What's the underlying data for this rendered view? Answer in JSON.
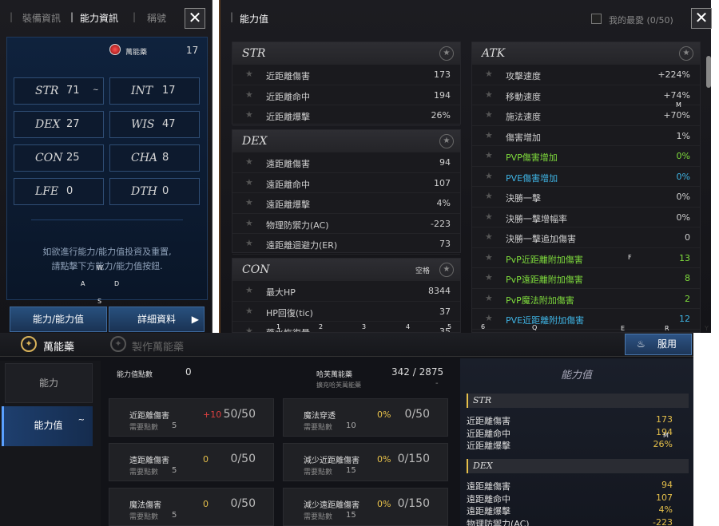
{
  "left_panel": {
    "tabs": [
      "裝備資訊",
      "能力資訊",
      "稱號"
    ],
    "elixir_label": "萬能藥",
    "elixir_count": "17",
    "stats": [
      {
        "name": "STR",
        "value": "71"
      },
      {
        "name": "INT",
        "value": "17"
      },
      {
        "name": "DEX",
        "value": "27"
      },
      {
        "name": "WIS",
        "value": "47"
      },
      {
        "name": "CON",
        "value": "25"
      },
      {
        "name": "CHA",
        "value": "8"
      },
      {
        "name": "LFE",
        "value": "0"
      },
      {
        "name": "DTH",
        "value": "0"
      }
    ],
    "hint_line1": "如欲進行能力/能力值投資及重置,",
    "hint_line2": "請點擊下方能力/能力值按鈕.",
    "btn_stats": "能力/能力值",
    "btn_details": "詳細資料"
  },
  "right_panel": {
    "title": "能力值",
    "favorites": "我的最愛 (0/50)",
    "str": {
      "title": "STR",
      "rows": [
        {
          "label": "近距離傷害",
          "value": "173"
        },
        {
          "label": "近距離命中",
          "value": "194"
        },
        {
          "label": "近距離爆擊",
          "value": "26%"
        }
      ]
    },
    "dex": {
      "title": "DEX",
      "rows": [
        {
          "label": "遠距離傷害",
          "value": "94"
        },
        {
          "label": "遠距離命中",
          "value": "107"
        },
        {
          "label": "遠距離爆擊",
          "value": "4%"
        },
        {
          "label": "物理防禦力(AC)",
          "value": "-223"
        },
        {
          "label": "遠距離迴避力(ER)",
          "value": "73"
        }
      ]
    },
    "con": {
      "title": "CON",
      "tag": "空格",
      "rows": [
        {
          "label": "最大HP",
          "value": "8344"
        },
        {
          "label": "HP回復(tic)",
          "value": "37"
        },
        {
          "label": "藥水恢復量",
          "value": "35"
        }
      ]
    },
    "atk": {
      "title": "ATK",
      "rows": [
        {
          "label": "攻擊速度",
          "value": "+224%"
        },
        {
          "label": "移動速度",
          "value": "+74%"
        },
        {
          "label": "施法速度",
          "value": "+70%"
        },
        {
          "label": "傷害增加",
          "value": "1%"
        },
        {
          "label": "PVP傷害增加",
          "value": "0%"
        },
        {
          "label": "PVE傷害增加",
          "value": "0%"
        },
        {
          "label": "決勝一擊",
          "value": "0%"
        },
        {
          "label": "決勝一擊增幅率",
          "value": "0%"
        },
        {
          "label": "決勝一擊追加傷害",
          "value": "0"
        },
        {
          "label": "PvP近距離附加傷害",
          "value": "13"
        },
        {
          "label": "PvP遠距離附加傷害",
          "value": "8"
        },
        {
          "label": "PvP魔法附加傷害",
          "value": "2"
        },
        {
          "label": "PVE近距離附加傷害",
          "value": "12"
        }
      ]
    }
  },
  "bottom": {
    "tab_elixir": "萬能藥",
    "tab_craft": "製作萬能藥",
    "btn_apply": "服用",
    "side_ability": "能力",
    "side_stats": "能力值",
    "points_label": "能力值點數",
    "points_value": "0",
    "hafi_label": "哈芙萬能藥",
    "hafi_value": "342 / 2875",
    "hafi_sub": "擴充哈芙萬能藥",
    "hafi_sub_value": "-",
    "need": "需要點數",
    "cards_left": [
      {
        "title": "近距離傷害",
        "cost": "5",
        "bonus": "+10",
        "count": "50/50"
      },
      {
        "title": "遠距離傷害",
        "cost": "5",
        "bonus": "0",
        "count": "0/50"
      },
      {
        "title": "魔法傷害",
        "cost": "5",
        "bonus": "0",
        "count": "0/50"
      }
    ],
    "cards_right": [
      {
        "title": "魔法穿透",
        "cost": "10",
        "bonus": "0%",
        "count": "0/50"
      },
      {
        "title": "減少近距離傷害",
        "cost": "15",
        "bonus": "0%",
        "count": "0/150"
      },
      {
        "title": "減少遠距離傷害",
        "cost": "15",
        "bonus": "0%",
        "count": "0/150"
      }
    ],
    "mini_title": "能力值",
    "mini_str": {
      "title": "STR",
      "rows": [
        {
          "label": "近距離傷害",
          "value": "173"
        },
        {
          "label": "近距離命中",
          "value": "194"
        },
        {
          "label": "近距離爆擊",
          "value": "26%"
        }
      ]
    },
    "mini_dex": {
      "title": "DEX",
      "rows": [
        {
          "label": "遠距離傷害",
          "value": "94"
        },
        {
          "label": "遠距離命中",
          "value": "107"
        },
        {
          "label": "遠距離爆擊",
          "value": "4%"
        },
        {
          "label": "物理防禦力(AC)",
          "value": "-223"
        }
      ]
    }
  },
  "overlay_keys": [
    "W",
    "A",
    "D",
    "S",
    "M",
    "1",
    "2",
    "3",
    "4",
    "5",
    "6",
    "Q",
    "E",
    "R",
    "Y",
    "F",
    "M"
  ]
}
